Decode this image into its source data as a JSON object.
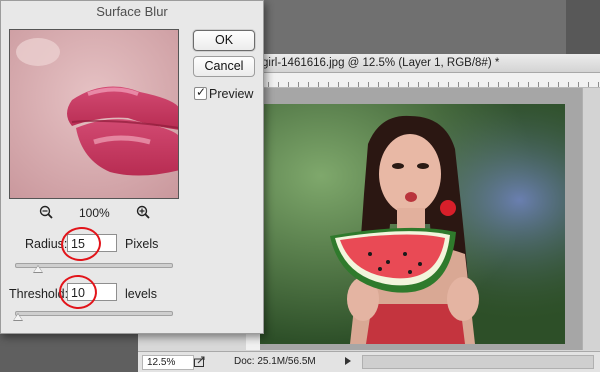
{
  "dialog": {
    "title": "Surface Blur",
    "ok_label": "OK",
    "cancel_label": "Cancel",
    "preview_label": "Preview",
    "preview_checked": true,
    "zoom_level": "100%",
    "zoom_out_icon": "zoom-out-magnifier",
    "zoom_in_icon": "zoom-in-magnifier",
    "radius": {
      "label": "Radius:",
      "value": "15",
      "unit": "Pixels",
      "slider_fraction": 0.15
    },
    "threshold": {
      "label": "Threshold:",
      "value": "10",
      "unit": "levels",
      "slider_fraction": 0.02
    }
  },
  "document": {
    "title": "girl-1461616.jpg @ 12.5% (Layer 1, RGB/8#) *",
    "status": {
      "zoom": "12.5%",
      "doc_info": "Doc: 25.1M/56.5M"
    }
  },
  "colors": {
    "dialog_bg": "#e8e8e8",
    "annotation_red": "#e2141a",
    "workspace_gray": "#5f5f5f"
  }
}
